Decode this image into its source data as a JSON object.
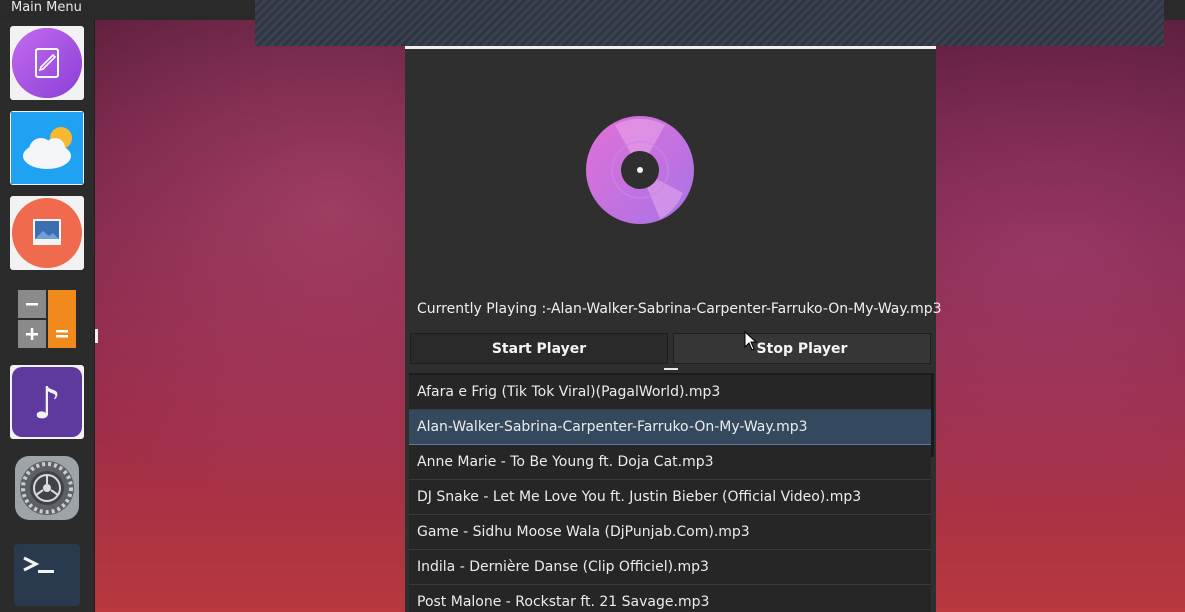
{
  "topbar": {
    "title": "Main Menu"
  },
  "dock": {
    "items": [
      {
        "name": "text-editor",
        "icon": "edit-document-icon"
      },
      {
        "name": "weather",
        "icon": "weather-cloud-sun-icon"
      },
      {
        "name": "image-viewer",
        "icon": "picture-icon"
      },
      {
        "name": "calculator",
        "icon": "calculator-icon",
        "glyphs": [
          "−",
          "+",
          "="
        ]
      },
      {
        "name": "music-player",
        "icon": "music-note-icon",
        "glyph": "♪"
      },
      {
        "name": "settings",
        "icon": "gear-icon"
      },
      {
        "name": "terminal",
        "icon": "terminal-icon",
        "glyph": ">_"
      }
    ]
  },
  "player": {
    "now_playing": "Currently Playing :-Alan-Walker-Sabrina-Carpenter-Farruko-On-My-Way.mp3",
    "start_label": "Start Player",
    "stop_label": "Stop Player",
    "playlist": [
      {
        "title": "Afara e Frig (Tik Tok Viral)(PagalWorld).mp3",
        "selected": false
      },
      {
        "title": "Alan-Walker-Sabrina-Carpenter-Farruko-On-My-Way.mp3",
        "selected": true
      },
      {
        "title": "Anne Marie - To Be Young ft. Doja Cat.mp3",
        "selected": false
      },
      {
        "title": "DJ Snake - Let Me Love You ft. Justin Bieber (Official Video).mp3",
        "selected": false
      },
      {
        "title": "Game - Sidhu Moose Wala (DjPunjab.Com).mp3",
        "selected": false
      },
      {
        "title": "Indila - Dernière Danse (Clip Officiel).mp3",
        "selected": false
      },
      {
        "title": "Post Malone - Rockstar ft. 21 Savage.mp3",
        "selected": false
      }
    ]
  },
  "colors": {
    "selection": "#34495e",
    "disc_pink": "#e26fd8",
    "disc_purple": "#a874e6",
    "window_bg": "#2f2f2f"
  }
}
